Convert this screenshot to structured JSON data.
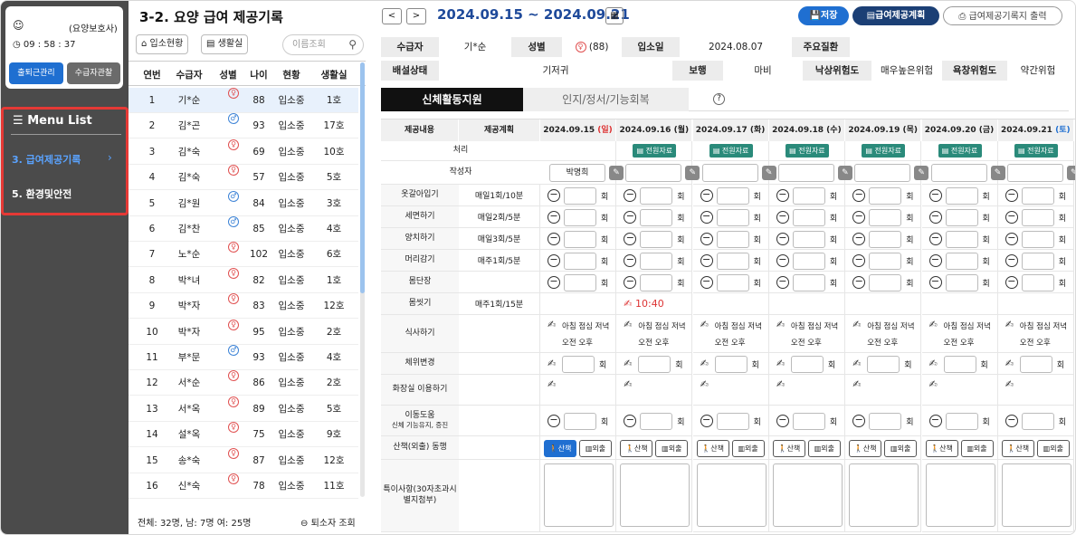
{
  "sidebar": {
    "user_role": "(요양보호사)",
    "time": "09 : 58 : 37",
    "btn_attendance": "출퇴근관리",
    "btn_observe": "수급자관찰",
    "menu_title": "Menu List",
    "menu_item1": "3. 급여제공기록",
    "menu_item2": "5. 환경및안전"
  },
  "list": {
    "title": "3-2. 요양 급여 제공기록",
    "btn_admit": "입소현황",
    "btn_room": "생활실",
    "search_placeholder": "이름조회",
    "headers": [
      "연번",
      "수급자",
      "성별",
      "나이",
      "현황",
      "생활실"
    ],
    "rows": [
      {
        "no": "1",
        "name": "기*순",
        "g": "f",
        "age": "88",
        "status": "입소중",
        "room": "1호"
      },
      {
        "no": "2",
        "name": "김*곤",
        "g": "m",
        "age": "93",
        "status": "입소중",
        "room": "17호"
      },
      {
        "no": "3",
        "name": "김*숙",
        "g": "f",
        "age": "69",
        "status": "입소중",
        "room": "10호"
      },
      {
        "no": "4",
        "name": "김*숙",
        "g": "f",
        "age": "57",
        "status": "입소중",
        "room": "5호"
      },
      {
        "no": "5",
        "name": "김*원",
        "g": "m",
        "age": "84",
        "status": "입소중",
        "room": "3호"
      },
      {
        "no": "6",
        "name": "김*찬",
        "g": "m",
        "age": "85",
        "status": "입소중",
        "room": "4호"
      },
      {
        "no": "7",
        "name": "노*순",
        "g": "f",
        "age": "102",
        "status": "입소중",
        "room": "6호"
      },
      {
        "no": "8",
        "name": "박*녀",
        "g": "f",
        "age": "82",
        "status": "입소중",
        "room": "1호"
      },
      {
        "no": "9",
        "name": "박*자",
        "g": "f",
        "age": "83",
        "status": "입소중",
        "room": "12호"
      },
      {
        "no": "10",
        "name": "박*자",
        "g": "f",
        "age": "95",
        "status": "입소중",
        "room": "2호"
      },
      {
        "no": "11",
        "name": "부*문",
        "g": "m",
        "age": "93",
        "status": "입소중",
        "room": "4호"
      },
      {
        "no": "12",
        "name": "서*순",
        "g": "f",
        "age": "86",
        "status": "입소중",
        "room": "2호"
      },
      {
        "no": "13",
        "name": "서*옥",
        "g": "f",
        "age": "89",
        "status": "입소중",
        "room": "5호"
      },
      {
        "no": "14",
        "name": "설*옥",
        "g": "f",
        "age": "75",
        "status": "입소중",
        "room": "9호"
      },
      {
        "no": "15",
        "name": "송*숙",
        "g": "f",
        "age": "87",
        "status": "입소중",
        "room": "12호"
      },
      {
        "no": "16",
        "name": "신*숙",
        "g": "f",
        "age": "78",
        "status": "입소중",
        "room": "11호"
      }
    ],
    "footer": "전체: 32명,  남: 7명  여: 25명",
    "footer_btn": "퇴소자 조회"
  },
  "main": {
    "prev": "<",
    "next": ">",
    "range": "2024.09.15 ~ 2024.09.21",
    "save": "저장",
    "plan": "급여제공계획",
    "print": "급여제공기록지 출력",
    "info": {
      "l_recipient": "수급자",
      "recipient": "기*순",
      "l_gender": "성별",
      "age": "(88)",
      "l_admit": "입소일",
      "admit": "2024.08.07",
      "l_disease": "주요질환",
      "disease": "",
      "l_excretion": "배설상태",
      "excretion": "기저귀",
      "l_walk": "보행",
      "walk": "마비",
      "l_fall": "낙상위험도",
      "fall": "매우높은위험",
      "l_sore": "욕창위험도",
      "sore": "약간위험"
    },
    "tab_physical": "신체활동지원",
    "tab_cognitive": "인지/정서/기능회복",
    "col_content": "제공내용",
    "col_plan": "제공계획",
    "dates": [
      {
        "d": "2024.09.15",
        "w": "(일)"
      },
      {
        "d": "2024.09.16",
        "w": "(월)"
      },
      {
        "d": "2024.09.17",
        "w": "(화)"
      },
      {
        "d": "2024.09.18",
        "w": "(수)"
      },
      {
        "d": "2024.09.19",
        "w": "(목)"
      },
      {
        "d": "2024.09.20",
        "w": "(금)"
      },
      {
        "d": "2024.09.21",
        "w": "(토)"
      }
    ],
    "rows": {
      "process": "처리",
      "writer": "작성자",
      "dress": "옷갈아입기",
      "wash": "세면하기",
      "teeth": "양치하기",
      "hair": "머리감기",
      "groom": "몸단장",
      "bath": "몸씻기",
      "meal": "식사하기",
      "position": "체위변경",
      "toilet": "화장실 이용하기",
      "move": "이동도움",
      "move_sub": "신체 기능유지, 증진",
      "walkout": "산책(외출) 동행",
      "note": "특이사항(30자초과시 별지첨부)"
    },
    "plans": {
      "dress": "매일1회/10분",
      "wash": "매일2회/5분",
      "teeth": "매일3회/5분",
      "hair": "매주1회/5분",
      "bath": "매주1회/15분"
    },
    "tag": "전원자료",
    "writer_name": "박명희",
    "hoe": "회",
    "bath_time": "10:40",
    "meal1": "아침 점심 저녁",
    "meal2": "오전 오후",
    "walk_btn": "산책",
    "out_btn": "외출"
  }
}
